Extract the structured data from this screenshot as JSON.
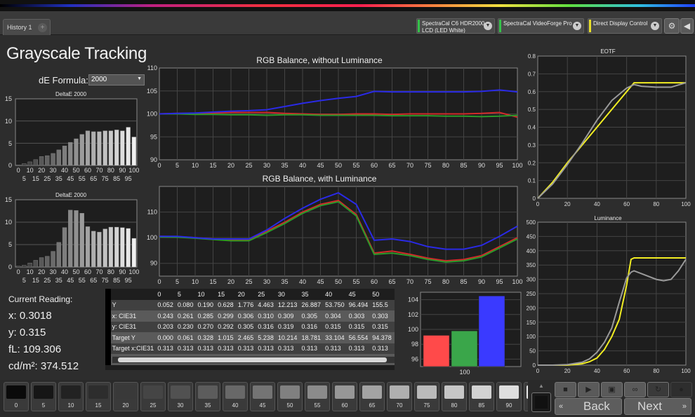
{
  "history_tab": {
    "label": "History 1",
    "plus": "+"
  },
  "devices": [
    {
      "line1": "SpectraCal C6 HDR2000",
      "line2": "LCD (LED White)",
      "stripe": "#35c24a"
    },
    {
      "line1": "SpectraCal VideoForge Pro",
      "line2": "",
      "stripe": "#35c24a"
    },
    {
      "line1": "Direct Display Control",
      "line2": "",
      "stripe": "#e8e02a"
    }
  ],
  "toolbar_icons": [
    "gear-icon",
    "arrow-left-icon"
  ],
  "page_title": "Grayscale Tracking",
  "formula": {
    "label": "dE Formula:",
    "value": "2000"
  },
  "delta_charts": [
    {
      "title": "DeltaE 2000",
      "yticks": [
        "0",
        "5",
        "10",
        "15"
      ],
      "xticks_top": [
        "0",
        "10",
        "20",
        "30",
        "40",
        "50",
        "60",
        "70",
        "80",
        "90",
        "100"
      ],
      "xticks_bottom": [
        "5",
        "15",
        "25",
        "35",
        "45",
        "55",
        "65",
        "75",
        "85",
        "95"
      ]
    },
    {
      "title": "DeltaE 2000",
      "yticks": [
        "0",
        "5",
        "10",
        "15"
      ],
      "xticks_top": [
        "0",
        "10",
        "20",
        "30",
        "40",
        "50",
        "60",
        "70",
        "80",
        "90",
        "100"
      ],
      "xticks_bottom": [
        "5",
        "15",
        "25",
        "35",
        "45",
        "55",
        "65",
        "75",
        "85",
        "95"
      ]
    }
  ],
  "chart_data": [
    {
      "type": "bar",
      "title": "DeltaE 2000",
      "categories": [
        0,
        5,
        10,
        15,
        20,
        25,
        30,
        35,
        40,
        45,
        50,
        55,
        60,
        65,
        70,
        75,
        80,
        85,
        90,
        95,
        100
      ],
      "values": [
        0.1,
        0.4,
        0.8,
        1.3,
        2.0,
        2.2,
        2.7,
        3.5,
        4.4,
        5.2,
        6.0,
        7.0,
        7.8,
        7.6,
        7.6,
        7.8,
        7.8,
        8.0,
        7.8,
        8.6,
        6.4
      ],
      "ylim": [
        0,
        15
      ]
    },
    {
      "type": "bar",
      "title": "DeltaE 2000",
      "categories": [
        0,
        5,
        10,
        15,
        20,
        25,
        30,
        35,
        40,
        45,
        50,
        55,
        60,
        65,
        70,
        75,
        80,
        85,
        90,
        95,
        100
      ],
      "values": [
        0.2,
        0.4,
        0.9,
        1.5,
        2.1,
        2.4,
        3.5,
        5.5,
        8.8,
        12.7,
        12.6,
        12.0,
        9.0,
        8.0,
        7.8,
        8.5,
        8.9,
        8.9,
        8.8,
        8.6,
        6.4
      ],
      "ylim": [
        0,
        15
      ]
    },
    {
      "type": "line",
      "title": "RGB Balance, without Luminance",
      "x": [
        0,
        5,
        10,
        15,
        20,
        25,
        30,
        35,
        40,
        45,
        50,
        55,
        60,
        65,
        70,
        75,
        80,
        85,
        90,
        95,
        100
      ],
      "xticks": [
        "0",
        "5",
        "10",
        "15",
        "20",
        "25",
        "30",
        "35",
        "40",
        "45",
        "50",
        "55",
        "60",
        "65",
        "70",
        "75",
        "80",
        "85",
        "90",
        "95",
        "100"
      ],
      "yticks": [
        "90",
        "95",
        "100",
        "105",
        "110"
      ],
      "ylim": [
        90,
        110
      ],
      "series": [
        {
          "color": "#d22a2a",
          "values": [
            100.0,
            100.1,
            100.1,
            100.2,
            100.3,
            100.3,
            100.3,
            100.1,
            100.0,
            99.9,
            99.9,
            100.0,
            100.0,
            99.9,
            100.0,
            100.0,
            100.0,
            100.0,
            100.1,
            100.3,
            99.3
          ]
        },
        {
          "color": "#2a9a2a",
          "values": [
            100.0,
            100.0,
            99.9,
            99.9,
            99.8,
            99.8,
            99.7,
            99.8,
            99.8,
            99.7,
            99.7,
            99.7,
            99.7,
            99.6,
            99.6,
            99.6,
            99.5,
            99.5,
            99.4,
            99.5,
            99.7
          ]
        },
        {
          "color": "#2a2ae6",
          "values": [
            100.0,
            100.1,
            100.2,
            100.4,
            100.6,
            100.7,
            100.9,
            101.6,
            102.3,
            102.9,
            103.4,
            103.8,
            104.9,
            104.8,
            104.8,
            104.8,
            104.8,
            104.8,
            104.9,
            105.2,
            104.8
          ]
        }
      ]
    },
    {
      "type": "line",
      "title": "RGB Balance, with Luminance",
      "x": [
        0,
        5,
        10,
        15,
        20,
        25,
        30,
        35,
        40,
        45,
        50,
        55,
        60,
        65,
        70,
        75,
        80,
        85,
        90,
        95,
        100
      ],
      "xticks": [
        "0",
        "5",
        "10",
        "15",
        "20",
        "25",
        "30",
        "35",
        "40",
        "45",
        "50",
        "55",
        "60",
        "65",
        "70",
        "75",
        "80",
        "85",
        "90",
        "95",
        "100"
      ],
      "yticks": [
        "90",
        "100",
        "110"
      ],
      "ylim": [
        85,
        120
      ],
      "series": [
        {
          "color": "#d22a2a",
          "values": [
            100.5,
            100.4,
            100.0,
            99.5,
            99.0,
            99.0,
            102.5,
            106.0,
            110.0,
            113.0,
            114.5,
            109.0,
            94.0,
            94.8,
            93.5,
            92.0,
            91.0,
            91.5,
            93.0,
            96.5,
            100.0
          ]
        },
        {
          "color": "#2a9a2a",
          "values": [
            100.3,
            100.2,
            99.8,
            99.3,
            98.8,
            98.8,
            102.0,
            105.5,
            109.5,
            112.5,
            114.0,
            108.5,
            93.5,
            94.0,
            93.0,
            91.5,
            90.5,
            91.0,
            92.5,
            96.0,
            99.5
          ]
        },
        {
          "color": "#2a2ae6",
          "values": [
            100.5,
            100.5,
            100.0,
            99.5,
            99.5,
            99.5,
            103.0,
            107.5,
            111.5,
            115.0,
            117.5,
            113.0,
            99.0,
            99.5,
            98.5,
            96.5,
            95.5,
            95.5,
            97.0,
            100.5,
            104.5
          ]
        }
      ]
    },
    {
      "type": "line",
      "title": "EOTF",
      "x": [
        0,
        10,
        20,
        30,
        40,
        50,
        60,
        65,
        70,
        80,
        90,
        100
      ],
      "xticks": [
        "0",
        "20",
        "40",
        "60",
        "80",
        "100"
      ],
      "yticks": [
        "0",
        "0.1",
        "0.2",
        "0.3",
        "0.4",
        "0.5",
        "0.6",
        "0.7",
        "0.8"
      ],
      "ylim": [
        0,
        0.8
      ],
      "series": [
        {
          "color": "#f2ee22",
          "values": [
            0.0,
            0.09,
            0.2,
            0.3,
            0.4,
            0.5,
            0.6,
            0.65,
            0.65,
            0.65,
            0.65,
            0.65
          ]
        },
        {
          "color": "#9a9a9a",
          "values": [
            0.0,
            0.08,
            0.19,
            0.31,
            0.44,
            0.55,
            0.62,
            0.64,
            0.63,
            0.625,
            0.625,
            0.65
          ]
        }
      ]
    },
    {
      "type": "line",
      "title": "Luminance",
      "x": [
        0,
        10,
        20,
        30,
        35,
        40,
        45,
        50,
        55,
        60,
        63,
        65,
        70,
        80,
        85,
        90,
        95,
        100
      ],
      "xticks": [
        "0",
        "20",
        "40",
        "60",
        "80",
        "100"
      ],
      "yticks": [
        "0",
        "50",
        "100",
        "150",
        "200",
        "250",
        "300",
        "350",
        "400",
        "450",
        "500"
      ],
      "ylim": [
        0,
        500
      ],
      "series": [
        {
          "color": "#f2ee22",
          "values": [
            0,
            0,
            0,
            5,
            12,
            25,
            55,
            100,
            160,
            280,
            370,
            375,
            375,
            375,
            375,
            375,
            375,
            375
          ]
        },
        {
          "color": "#9a9a9a",
          "values": [
            0,
            0,
            2,
            10,
            22,
            45,
            80,
            130,
            220,
            305,
            325,
            330,
            320,
            300,
            295,
            300,
            330,
            370
          ]
        }
      ]
    },
    {
      "type": "bar",
      "categories": [
        "R",
        "G",
        "B"
      ],
      "values": [
        99.2,
        99.8,
        104.5
      ],
      "colors": [
        "#ff4a4a",
        "#3aa64a",
        "#3a3aff"
      ],
      "xlabel": "100",
      "yticks": [
        "96",
        "98",
        "100",
        "102",
        "104"
      ],
      "ylim": [
        95,
        105
      ]
    }
  ],
  "current_reading": {
    "title": "Current Reading:",
    "x": "x: 0.3018",
    "y": "y: 0.315",
    "fl": "fL: 109.306",
    "cdm2": "cd/m²: 374.512"
  },
  "measurements": {
    "header": [
      "",
      "0",
      "5",
      "10",
      "15",
      "20",
      "25",
      "30",
      "35",
      "40",
      "45",
      "50"
    ],
    "rows": [
      {
        "label": "Y",
        "values": [
          "0.052",
          "0.080",
          "0.190",
          "0.628",
          "1.776",
          "4.463",
          "12.213",
          "26.887",
          "53.750",
          "96.494",
          "155.5"
        ]
      },
      {
        "label": "x: CIE31",
        "values": [
          "0.243",
          "0.261",
          "0.285",
          "0.299",
          "0.306",
          "0.310",
          "0.309",
          "0.305",
          "0.304",
          "0.303",
          "0.303"
        ]
      },
      {
        "label": "y: CIE31",
        "values": [
          "0.203",
          "0.230",
          "0.270",
          "0.292",
          "0.305",
          "0.316",
          "0.319",
          "0.316",
          "0.315",
          "0.315",
          "0.315"
        ]
      },
      {
        "label": "Target Y",
        "values": [
          "0.000",
          "0.061",
          "0.328",
          "1.015",
          "2.465",
          "5.238",
          "10.214",
          "18.781",
          "33.104",
          "56.554",
          "94.378"
        ]
      },
      {
        "label": "Target x:CIE31",
        "values": [
          "0.313",
          "0.313",
          "0.313",
          "0.313",
          "0.313",
          "0.313",
          "0.313",
          "0.313",
          "0.313",
          "0.313",
          "0.313"
        ]
      },
      {
        "label": "Target y:CIE31",
        "values": [
          "0.329",
          "0.329",
          "0.329",
          "0.329",
          "0.329",
          "0.329",
          "0.329",
          "0.329",
          "0.329",
          "0.329",
          "0.329"
        ]
      }
    ]
  },
  "patches": [
    {
      "label": "0",
      "level": 0
    },
    {
      "label": "5",
      "level": 5
    },
    {
      "label": "10",
      "level": 10
    },
    {
      "label": "15",
      "level": 15
    },
    {
      "label": "20",
      "level": 20
    },
    {
      "label": "25",
      "level": 25
    },
    {
      "label": "30",
      "level": 30
    },
    {
      "label": "35",
      "level": 35
    },
    {
      "label": "40",
      "level": 40
    },
    {
      "label": "45",
      "level": 45
    },
    {
      "label": "50",
      "level": 50
    },
    {
      "label": "55",
      "level": 55
    },
    {
      "label": "60",
      "level": 60
    },
    {
      "label": "65",
      "level": 65
    },
    {
      "label": "70",
      "level": 70
    },
    {
      "label": "75",
      "level": 75
    },
    {
      "label": "80",
      "level": 80
    },
    {
      "label": "85",
      "level": 85
    },
    {
      "label": "90",
      "level": 90
    },
    {
      "label": "95",
      "level": 95
    }
  ],
  "controls": {
    "icons": [
      "stop-icon",
      "play-icon",
      "save-icon",
      "loop-icon",
      "refresh-icon",
      "record-icon"
    ],
    "back_label": "Back",
    "next_label": "Next"
  }
}
